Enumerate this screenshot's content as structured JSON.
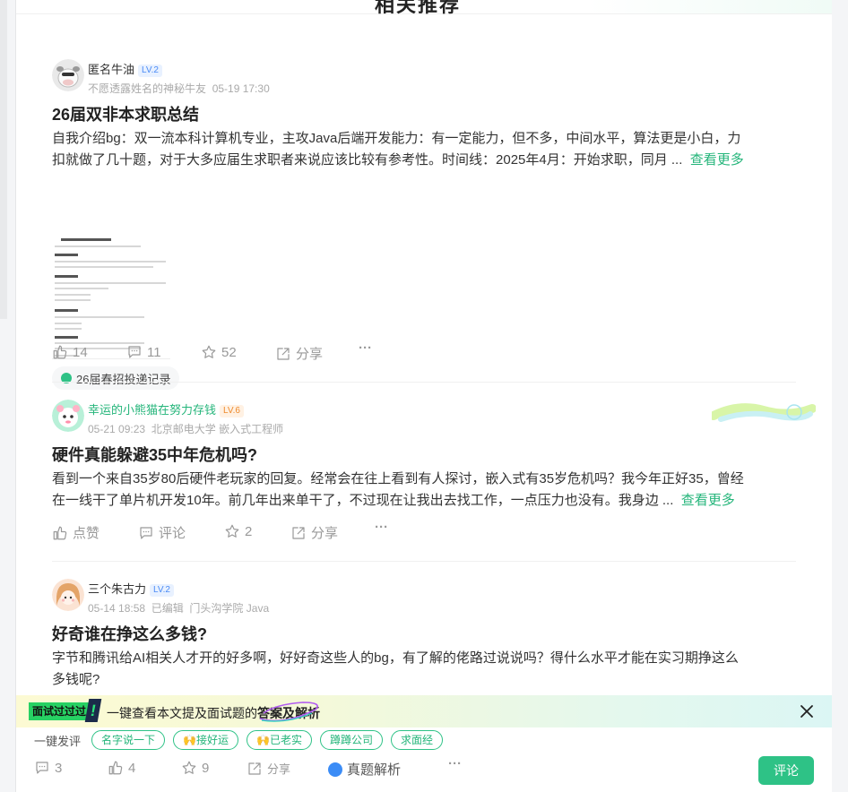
{
  "section": {
    "title": "相关推荐"
  },
  "posts": [
    {
      "user": {
        "name": "匿名牛油",
        "level": "LV.2",
        "avatar": "cow-avatar"
      },
      "meta": {
        "subtitle": "不愿透露姓名的神秘牛友",
        "time": "05-19 17:30"
      },
      "title": "26届双非本求职总结",
      "excerpt_line1": "自我介绍bg：双一流本科计算机专业，主攻Java后端开发能力：有一定能力，但不多，中间水平，算法更是小白，力",
      "excerpt_line2": "扣就做了几十题，对于大多应届生求职者来说应该比较有参考性。时间线：2025年4月：开始求职，同月 ...",
      "more": "查看更多",
      "tag": "26届春招投递记录",
      "actions": {
        "like": "14",
        "comment": "11",
        "star": "52",
        "share": "分享",
        "more": "···"
      }
    },
    {
      "user": {
        "name": "幸运的小熊猫在努力存钱",
        "level": "LV.6",
        "avatar": "panda-avatar"
      },
      "meta": {
        "time": "05-21 09:23",
        "school": "北京邮电大学",
        "job": "嵌入式工程师"
      },
      "title": "硬件真能躲避35中年危机吗?",
      "excerpt_line1": "看到一个来自35岁80后硬件老玩家的回复。经常会在往上看到有人探讨，嵌入式有35岁危机吗？我今年正好35，曾经",
      "excerpt_line2": "在一线干了单片机开发10年。前几年出来单干了，不过现在让我出去找工作，一点压力也没有。我身边 ...",
      "more": "查看更多",
      "actions": {
        "like": "点赞",
        "comment": "评论",
        "star": "2",
        "share": "分享",
        "more": "···"
      }
    },
    {
      "user": {
        "name": "三个朱古力",
        "level": "LV.2",
        "avatar": "girl-avatar"
      },
      "meta": {
        "time": "05-14 18:58",
        "edited": "已编辑",
        "school": "门头沟学院",
        "job": "Java"
      },
      "title": "好奇谁在挣这么多钱?",
      "excerpt_line1": "字节和腾讯给AI相关人才开的好多啊，好好奇这些人的bg，有了解的佬路过说说吗？得什么水平才能在实习期挣这么",
      "excerpt_line2": "多钱呢?"
    }
  ],
  "banner": {
    "badge": "面试过过过",
    "exclaim": "!",
    "text_prefix": "一键查看本文提及面试题的",
    "text_highlight": "答案及解析"
  },
  "quick_reply": {
    "label": "一键发评",
    "chips": [
      "名字说一下",
      "接好运",
      "已老实",
      "蹲蹲公司",
      "求面经"
    ]
  },
  "bottom_bar": {
    "comment_count": "3",
    "like_count": "4",
    "star_count": "9",
    "share": "分享",
    "jiexi": "真题解析",
    "more": "···",
    "comment_button": "评论"
  },
  "colors": {
    "accent": "#2ec286",
    "level_blue": "#4b8bf5",
    "level_orange": "#ee8a2c"
  }
}
